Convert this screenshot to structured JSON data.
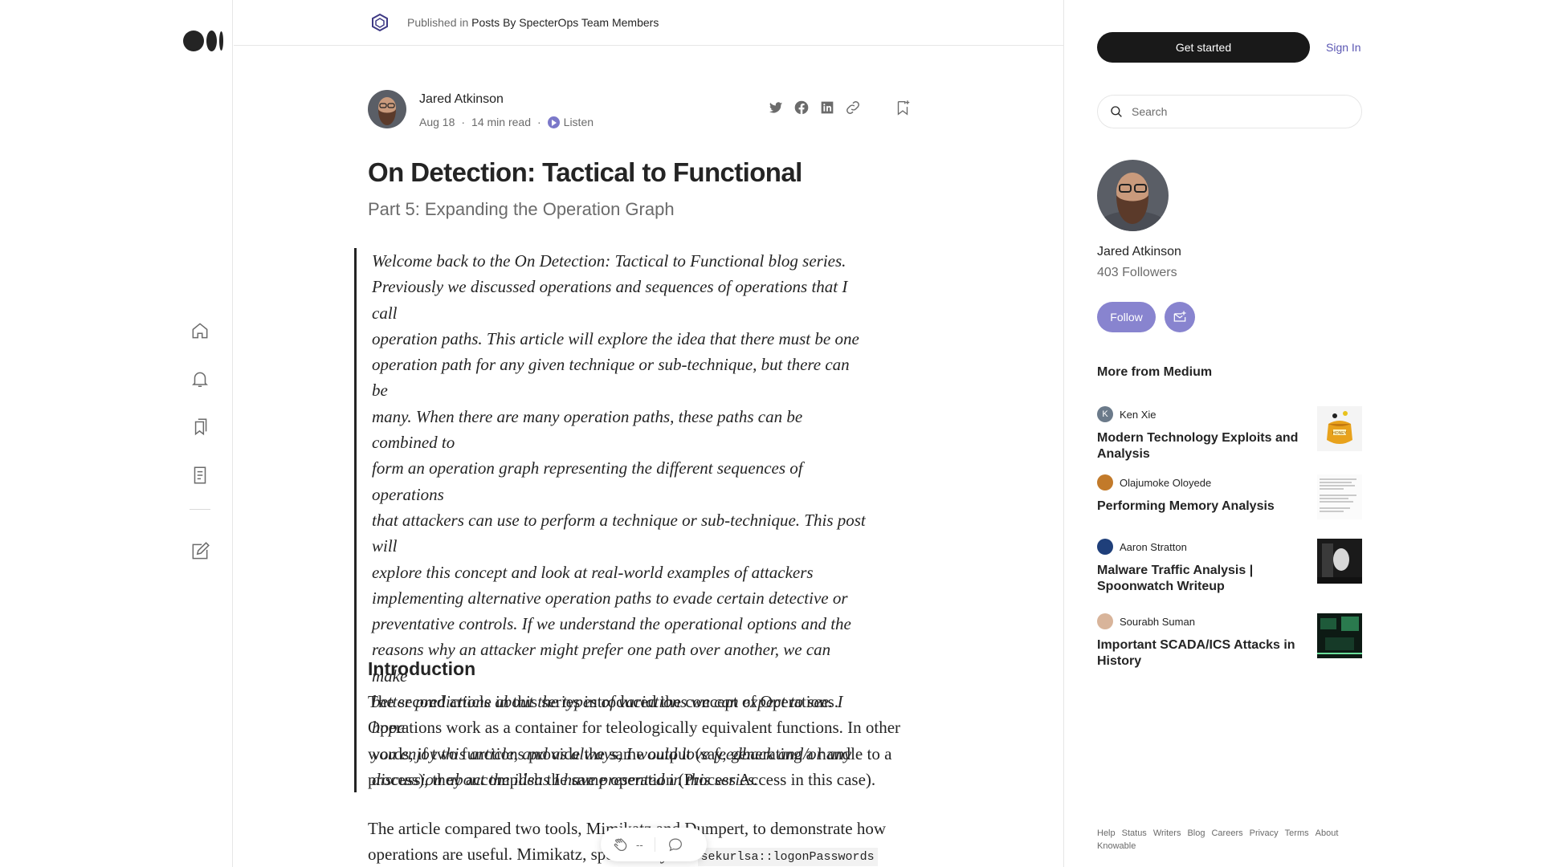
{
  "nav": {
    "logo_icon": "medium-logo-icon",
    "icons": [
      "home-icon",
      "bell-icon",
      "bookmarks-icon",
      "stories-icon",
      "write-icon"
    ]
  },
  "publication": {
    "prefix": "Published in",
    "name": "Posts By SpecterOps Team Members",
    "logo_icon": "specterops-logo-icon"
  },
  "article": {
    "author": "Jared Atkinson",
    "date": "Aug 18",
    "separator": "·",
    "read_time": "14 min read",
    "listen_label": "Listen",
    "share_icons": [
      "twitter-icon",
      "facebook-icon",
      "linkedin-icon",
      "link-icon",
      "bookmark-add-icon"
    ],
    "title": "On Detection: Tactical to Functional",
    "subtitle": "Part 5: Expanding the Operation Graph",
    "quote_lines": [
      "Welcome back to the On Detection: Tactical to Functional blog series.",
      "Previously we discussed operations and sequences of operations that I call",
      "operation paths. This article will explore the idea that there must be one",
      "operation path for any given technique or sub-technique, but there can be",
      "many. When there are many operation paths, these paths can be combined to",
      "form an operation graph representing the different sequences of operations",
      "that attackers can use to perform a technique or sub-technique. This post will",
      "explore this concept and look at real-world examples of attackers",
      "implementing alternative operation paths to evade certain detective or",
      "preventative controls. If we understand the operational options and the",
      "reasons why an attacker might prefer one path over another, we can make",
      "better predictions about the types of variations we can expect to see. I hope",
      "you enjoy this article, and as always, I would love feedback and/or any",
      "discussion about the ideas I have presented in this series."
    ],
    "section_heading": "Introduction",
    "para1_lines": [
      "The second article in this series introduced the concept of Operations.",
      "Operations work as a container for teleologically equivalent functions. In other",
      "words, if two functions provide the same output (say, generating a handle to a",
      "process), they accomplish the same operation (Process Access in this case)."
    ],
    "para2_line1": "The article compared two tools, Mimikatz and Dumpert, to demonstrate how",
    "para2_line2_text": "operations are useful. Mimikatz, specifically the",
    "para2_code": "sekurlsa::logonPasswords",
    "clap_count": "--"
  },
  "sidebar": {
    "get_started": "Get started",
    "sign_in": "Sign In",
    "search_placeholder": "Search",
    "author_name": "Jared Atkinson",
    "followers": "403 Followers",
    "follow_label": "Follow",
    "more_from": "More from Medium",
    "recommendations": [
      {
        "author": "Ken Xie",
        "avatar_letter": "K",
        "title": "Modern Technology Exploits and Analysis"
      },
      {
        "author": "Olajumoke Oloyede",
        "avatar_letter": "",
        "title": "Performing Memory Analysis"
      },
      {
        "author": "Aaron Stratton",
        "avatar_letter": "",
        "title": "Malware Traffic Analysis | Spoonwatch Writeup"
      },
      {
        "author": "Sourabh Suman",
        "avatar_letter": "",
        "title": "Important SCADA/ICS Attacks in History"
      }
    ],
    "thumb1_label": "HONEY",
    "footer_links": [
      "Help",
      "Status",
      "Writers",
      "Blog",
      "Careers",
      "Privacy",
      "Terms",
      "About",
      "Knowable"
    ]
  },
  "colors": {
    "accent": "#8884cf",
    "brand_dark": "#191919",
    "text": "#242424",
    "muted": "#6b6b6b"
  }
}
